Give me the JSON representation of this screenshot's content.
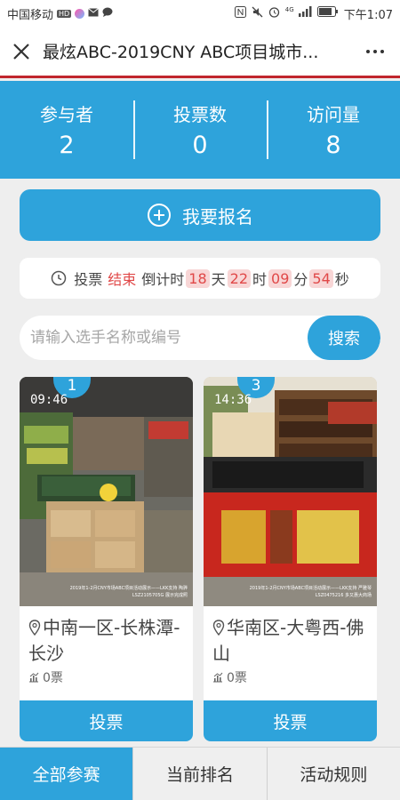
{
  "statusbar": {
    "carrier": "中国移动",
    "hd": "HD",
    "network": "4G",
    "time": "下午1:07"
  },
  "titlebar": {
    "title": "最炫ABC-2019CNY ABC项目城市..."
  },
  "stats": [
    {
      "label": "参与者",
      "value": "2"
    },
    {
      "label": "投票数",
      "value": "0"
    },
    {
      "label": "访问量",
      "value": "8"
    }
  ],
  "signup": {
    "label": "我要报名"
  },
  "countdown": {
    "prefix": "投票",
    "status": "结束",
    "countdown_label": "倒计时",
    "days": "18",
    "days_unit": "天",
    "hours": "22",
    "hours_unit": "时",
    "minutes": "09",
    "minutes_unit": "分",
    "seconds": "54",
    "seconds_unit": "秒"
  },
  "search": {
    "placeholder": "请输入选手名称或编号",
    "button": "搜索"
  },
  "candidates": [
    {
      "rank": "1",
      "photo_time": "09:46",
      "photo_caption": "2019年1-2月CNY市场ABC项目活动展示——LKK支持 陶骅 LSZ2105705G 展示完成照",
      "name": "中南一区-长株潭-长沙",
      "votes": "0票",
      "vote_button": "投票"
    },
    {
      "rank": "3",
      "photo_time": "14:36",
      "photo_caption": "2019年1-2月CNY市场ABC项目活动展示——LKK支持 严雅琴 LSZ0475216 多又惠大商场",
      "name": "华南区-大粤西-佛山",
      "votes": "0票",
      "vote_button": "投票"
    }
  ],
  "bottomnav": [
    {
      "label": "全部参赛",
      "active": true
    },
    {
      "label": "当前排名",
      "active": false
    },
    {
      "label": "活动规则",
      "active": false
    }
  ],
  "colors": {
    "accent": "#2ea3db",
    "highlight": "#e04848",
    "titlebar_border": "#c0262d"
  }
}
